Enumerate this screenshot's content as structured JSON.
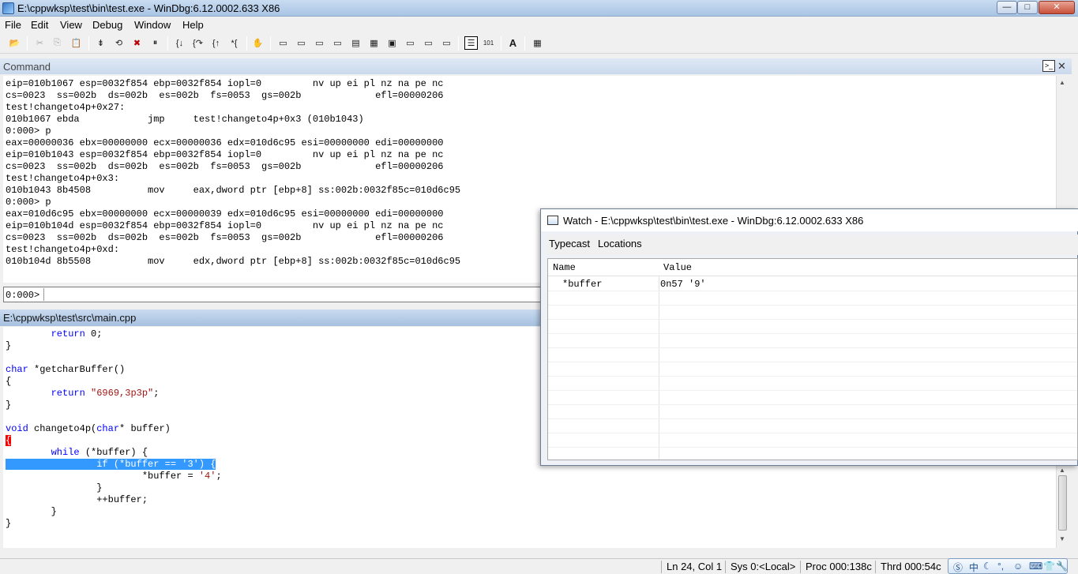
{
  "window": {
    "title": "E:\\cppwksp\\test\\bin\\test.exe - WinDbg:6.12.0002.633 X86",
    "controls": {
      "minimize": "—",
      "maximize": "□",
      "close": "✕"
    }
  },
  "menu": {
    "file": "File",
    "edit": "Edit",
    "view": "View",
    "debug": "Debug",
    "window": "Window",
    "help": "Help"
  },
  "toolbar": {
    "icons": [
      "open-icon",
      "cut-icon",
      "copy-icon",
      "paste-icon",
      "go-icon",
      "restart-icon",
      "stop-icon",
      "break-icon",
      "step-into-icon",
      "step-over-icon",
      "step-out-icon",
      "run-to-cursor-icon",
      "hand-icon",
      "command-window-icon",
      "watch-window-icon",
      "locals-window-icon",
      "registers-window-icon",
      "memory-window-icon",
      "call-stack-icon",
      "disassembly-icon",
      "scratch-pad-icon",
      "processes-icon",
      "source-mode-icon",
      "hex-mode-icon",
      "font-icon",
      "options-icon"
    ],
    "hex_label": "101",
    "font_label": "A"
  },
  "command": {
    "title": "Command",
    "close": "✕",
    "lines": [
      "eip=010b1067 esp=0032f854 ebp=0032f854 iopl=0         nv up ei pl nz na pe nc",
      "cs=0023  ss=002b  ds=002b  es=002b  fs=0053  gs=002b             efl=00000206",
      "test!changeto4p+0x27:",
      "010b1067 ebda            jmp     test!changeto4p+0x3 (010b1043)",
      "0:000> p",
      "eax=00000036 ebx=00000000 ecx=00000036 edx=010d6c95 esi=00000000 edi=00000000",
      "eip=010b1043 esp=0032f854 ebp=0032f854 iopl=0         nv up ei pl nz na pe nc",
      "cs=0023  ss=002b  ds=002b  es=002b  fs=0053  gs=002b             efl=00000206",
      "test!changeto4p+0x3:",
      "010b1043 8b4508          mov     eax,dword ptr [ebp+8] ss:002b:0032f85c=010d6c95",
      "0:000> p",
      "eax=010d6c95 ebx=00000000 ecx=00000039 edx=010d6c95 esi=00000000 edi=00000000",
      "eip=010b104d esp=0032f854 ebp=0032f854 iopl=0         nv up ei pl nz na pe nc",
      "cs=0023  ss=002b  ds=002b  es=002b  fs=0053  gs=002b             efl=00000206",
      "test!changeto4p+0xd:",
      "010b104d 8b5508          mov     edx,dword ptr [ebp+8] ss:002b:0032f85c=010d6c95"
    ],
    "prompt": "0:000>",
    "input_value": ""
  },
  "source": {
    "title": "E:\\cppwksp\\test\\src\\main.cpp",
    "lines": {
      "l1_indent": "        ",
      "l1_kw": "return",
      "l1_rest": " 0;",
      "l2": "}",
      "l3": "",
      "l4_kw": "char",
      "l4_rest": " *getcharBuffer()",
      "l5": "{",
      "l6_indent": "        ",
      "l6_kw": "return",
      "l6_sp": " ",
      "l6_str": "\"6969,3p3p\"",
      "l6_end": ";",
      "l7": "}",
      "l8": "",
      "l9_kw": "void",
      "l9_mid": " changeto4p(",
      "l9_kw2": "char",
      "l9_rest": "* buffer)",
      "l10": "{",
      "l11_indent": "        ",
      "l11_kw": "while",
      "l11_rest": " (*buffer) {",
      "l12_indent": "                ",
      "l12_kw": "if",
      "l12_mid": " (*buffer == ",
      "l12_str": "'3'",
      "l12_rest": ") {",
      "l13_code": "                        *buffer = ",
      "l13_str": "'4'",
      "l13_end": ";",
      "l14": "                }",
      "l15": "                ++buffer;",
      "l16": "        }",
      "l17": "}"
    }
  },
  "watch": {
    "title": "Watch - E:\\cppwksp\\test\\bin\\test.exe - WinDbg:6.12.0002.633 X86",
    "menu_typecast": "Typecast",
    "menu_locations": "Locations",
    "col_name": "Name",
    "col_value": "Value",
    "rows": [
      {
        "name": "*buffer",
        "value": "0n57 '9'"
      }
    ]
  },
  "status": {
    "ln_col": "Ln 24, Col 1",
    "sys": "Sys 0:<Local>",
    "proc": "Proc 000:138c",
    "thrd": "Thrd 000:54c"
  },
  "ime": {
    "mode": "中",
    "punct": "°,",
    "extra": "☺"
  }
}
